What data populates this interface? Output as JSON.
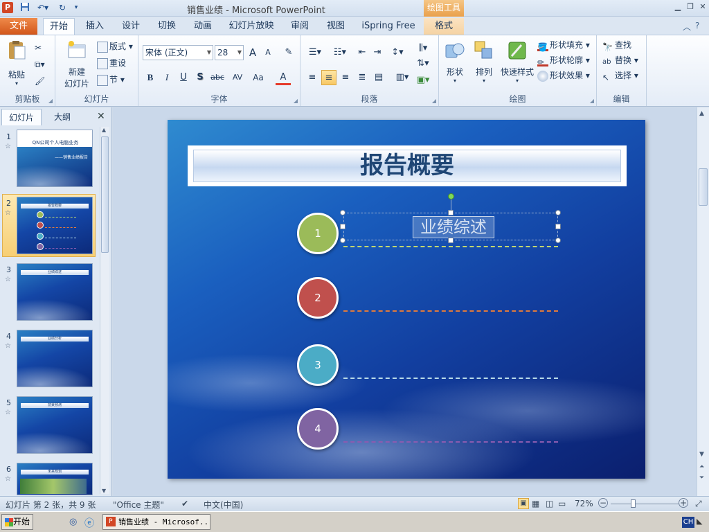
{
  "window": {
    "title": "销售业绩  -  Microsoft PowerPoint",
    "app_icon": "P",
    "context_tab_header": "绘图工具"
  },
  "tabs": {
    "file": "文件",
    "items": [
      "开始",
      "插入",
      "设计",
      "切换",
      "动画",
      "幻灯片放映",
      "审阅",
      "视图",
      "iSpring Free",
      "格式"
    ]
  },
  "ribbon": {
    "clipboard": {
      "label": "剪贴板",
      "paste": "粘贴"
    },
    "slides": {
      "label": "幻灯片",
      "new_slide_line1": "新建",
      "new_slide_line2": "幻灯片",
      "layout": "版式",
      "reset": "重设",
      "section": "节"
    },
    "font": {
      "label": "字体",
      "font_name": "宋体 (正文)",
      "font_size": "28",
      "bold": "B",
      "italic": "I",
      "underline": "U",
      "shadow": "S",
      "strike": "abc",
      "spacing": "AV",
      "case": "Aa",
      "grow": "A",
      "shrink": "A",
      "color": "A"
    },
    "paragraph": {
      "label": "段落"
    },
    "drawing": {
      "label": "绘图",
      "shapes": "形状",
      "arrange": "排列",
      "quick_styles": "快速样式",
      "shape_fill": "形状填充",
      "shape_outline": "形状轮廓",
      "shape_effects": "形状效果"
    },
    "editing": {
      "label": "编辑",
      "find": "查找",
      "replace": "替换",
      "select": "选择"
    }
  },
  "left_pane": {
    "tab_slides": "幻灯片",
    "tab_outline": "大纲",
    "close": "✕",
    "thumbs": [
      {
        "num": "1",
        "title": "QN公司个人电脑业务",
        "subtitle": "——销售业绩报告"
      },
      {
        "num": "2",
        "title": "报告概要"
      },
      {
        "num": "3",
        "title": "业绩综述"
      },
      {
        "num": "4",
        "title": "业绩分析"
      },
      {
        "num": "5",
        "title": "前景预测"
      },
      {
        "num": "6",
        "title": "未来规划"
      }
    ]
  },
  "slide": {
    "title": "报告概要",
    "items": [
      {
        "num": "1",
        "text": "业绩综述",
        "color": "#9bbb59",
        "line": "#c2d66f"
      },
      {
        "num": "2",
        "text": "",
        "color": "#c0504d",
        "line": "#e07a3c"
      },
      {
        "num": "3",
        "text": "",
        "color": "#4bacc6",
        "line": "#b9dbe8"
      },
      {
        "num": "4",
        "text": "",
        "color": "#8064a2",
        "line": "#8a5cb0"
      }
    ]
  },
  "statusbar": {
    "slide_info": "幻灯片 第 2 张，共 9 张",
    "theme": "\"Office 主题\"",
    "language": "中文(中国)",
    "zoom": "72%"
  },
  "taskbar": {
    "start": "开始",
    "ppt_task": "销售业绩 - Microsof...",
    "ime": "CH"
  }
}
